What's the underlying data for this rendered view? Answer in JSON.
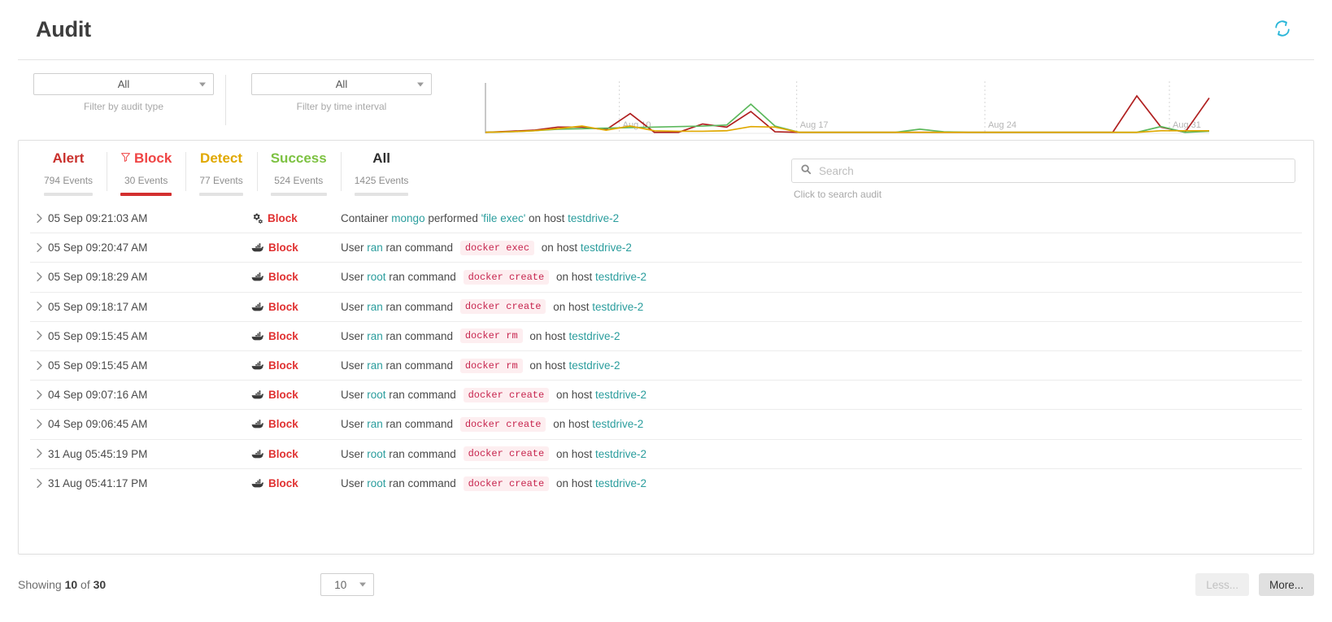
{
  "header": {
    "title": "Audit",
    "refresh_icon": "refresh-icon",
    "refresh_color": "#29b6d8"
  },
  "filters": [
    {
      "value": "All",
      "caption": "Filter by audit type",
      "name": "audit-type"
    },
    {
      "value": "All",
      "caption": "Filter by time interval",
      "name": "time-interval"
    }
  ],
  "chart_data": {
    "type": "line",
    "title": "",
    "xlabel": "",
    "ylabel": "",
    "grid": false,
    "legend": "none",
    "tick_labels": [
      "Aug 10",
      "Aug 17",
      "Aug 24",
      "Aug 31"
    ],
    "tick_positions": [
      0.128,
      0.598,
      0.895,
      0.845
    ],
    "x": [
      0,
      1,
      2,
      3,
      4,
      5,
      6,
      7,
      8,
      9,
      10,
      11,
      12,
      13,
      14,
      15,
      16,
      17,
      18,
      19,
      20,
      21,
      22,
      23,
      24,
      25,
      26,
      27,
      28,
      29,
      30
    ],
    "ylim": [
      0,
      100
    ],
    "series": [
      {
        "name": "Alert",
        "color": "#b02020",
        "values": [
          2,
          4,
          6,
          12,
          12,
          7,
          38,
          2,
          2,
          18,
          12,
          42,
          3,
          2,
          2,
          2,
          2,
          2,
          2,
          2,
          2,
          2,
          2,
          2,
          2,
          2,
          2,
          72,
          12,
          2,
          68
        ]
      },
      {
        "name": "Success",
        "color": "#5cb85c",
        "values": [
          2,
          3,
          5,
          8,
          9,
          10,
          11,
          12,
          13,
          14,
          16,
          56,
          14,
          2,
          2,
          2,
          2,
          2,
          8,
          3,
          2,
          2,
          2,
          2,
          2,
          2,
          2,
          2,
          13,
          2,
          4
        ]
      },
      {
        "name": "Detect",
        "color": "#e0a800",
        "values": [
          2,
          3,
          5,
          9,
          14,
          6,
          14,
          5,
          4,
          4,
          5,
          13,
          12,
          2,
          2,
          2,
          2,
          2,
          2,
          2,
          2,
          2,
          2,
          2,
          2,
          2,
          2,
          2,
          5,
          5,
          5
        ]
      }
    ]
  },
  "tabs": [
    {
      "label": "Alert",
      "count": "794 Events",
      "color": "#c9302c",
      "active": false,
      "icon": ""
    },
    {
      "label": "Block",
      "count": "30 Events",
      "color": "#ef4444",
      "active": true,
      "icon": "filter-icon"
    },
    {
      "label": "Detect",
      "count": "77 Events",
      "color": "#e0a800",
      "active": false,
      "icon": ""
    },
    {
      "label": "Success",
      "count": "524 Events",
      "color": "#7dc242",
      "active": false,
      "icon": ""
    },
    {
      "label": "All",
      "count": "1425 Events",
      "color": "#2f2f2f",
      "active": false,
      "icon": ""
    }
  ],
  "search": {
    "placeholder": "Search",
    "value": "",
    "caption": "Click to search audit",
    "icon": "search-icon"
  },
  "rows": [
    {
      "time": "05 Sep 09:21:03 AM",
      "status": "Block",
      "icon": "gears-icon",
      "desc_pre": "Container ",
      "subject": "mongo",
      "desc_mid": " performed ",
      "quoted": "'file exec'",
      "code": "",
      "desc_post": " on host ",
      "host": "testdrive-2"
    },
    {
      "time": "05 Sep 09:20:47 AM",
      "status": "Block",
      "icon": "docker-icon",
      "desc_pre": "User ",
      "subject": "ran",
      "desc_mid": " ran command ",
      "quoted": "",
      "code": "docker exec",
      "desc_post": " on host ",
      "host": "testdrive-2"
    },
    {
      "time": "05 Sep 09:18:29 AM",
      "status": "Block",
      "icon": "docker-icon",
      "desc_pre": "User ",
      "subject": "root",
      "desc_mid": " ran command ",
      "quoted": "",
      "code": "docker create",
      "desc_post": " on host ",
      "host": "testdrive-2"
    },
    {
      "time": "05 Sep 09:18:17 AM",
      "status": "Block",
      "icon": "docker-icon",
      "desc_pre": "User ",
      "subject": "ran",
      "desc_mid": " ran command ",
      "quoted": "",
      "code": "docker create",
      "desc_post": " on host ",
      "host": "testdrive-2"
    },
    {
      "time": "05 Sep 09:15:45 AM",
      "status": "Block",
      "icon": "docker-icon",
      "desc_pre": "User ",
      "subject": "ran",
      "desc_mid": " ran command ",
      "quoted": "",
      "code": "docker rm",
      "desc_post": " on host ",
      "host": "testdrive-2"
    },
    {
      "time": "05 Sep 09:15:45 AM",
      "status": "Block",
      "icon": "docker-icon",
      "desc_pre": "User ",
      "subject": "ran",
      "desc_mid": " ran command ",
      "quoted": "",
      "code": "docker rm",
      "desc_post": " on host ",
      "host": "testdrive-2"
    },
    {
      "time": "04 Sep 09:07:16 AM",
      "status": "Block",
      "icon": "docker-icon",
      "desc_pre": "User ",
      "subject": "root",
      "desc_mid": " ran command ",
      "quoted": "",
      "code": "docker create",
      "desc_post": " on host ",
      "host": "testdrive-2"
    },
    {
      "time": "04 Sep 09:06:45 AM",
      "status": "Block",
      "icon": "docker-icon",
      "desc_pre": "User ",
      "subject": "ran",
      "desc_mid": " ran command ",
      "quoted": "",
      "code": "docker create",
      "desc_post": " on host ",
      "host": "testdrive-2"
    },
    {
      "time": "31 Aug 05:45:19 PM",
      "status": "Block",
      "icon": "docker-icon",
      "desc_pre": "User ",
      "subject": "root",
      "desc_mid": " ran command ",
      "quoted": "",
      "code": "docker create",
      "desc_post": " on host ",
      "host": "testdrive-2"
    },
    {
      "time": "31 Aug 05:41:17 PM",
      "status": "Block",
      "icon": "docker-icon",
      "desc_pre": "User ",
      "subject": "root",
      "desc_mid": " ran command ",
      "quoted": "",
      "code": "docker create",
      "desc_post": " on host ",
      "host": "testdrive-2"
    }
  ],
  "footer": {
    "showing_prefix": "Showing ",
    "showing_count": "10",
    "showing_middle": " of ",
    "showing_total": "30",
    "page_size": "10",
    "less_label": "Less...",
    "more_label": "More..."
  }
}
